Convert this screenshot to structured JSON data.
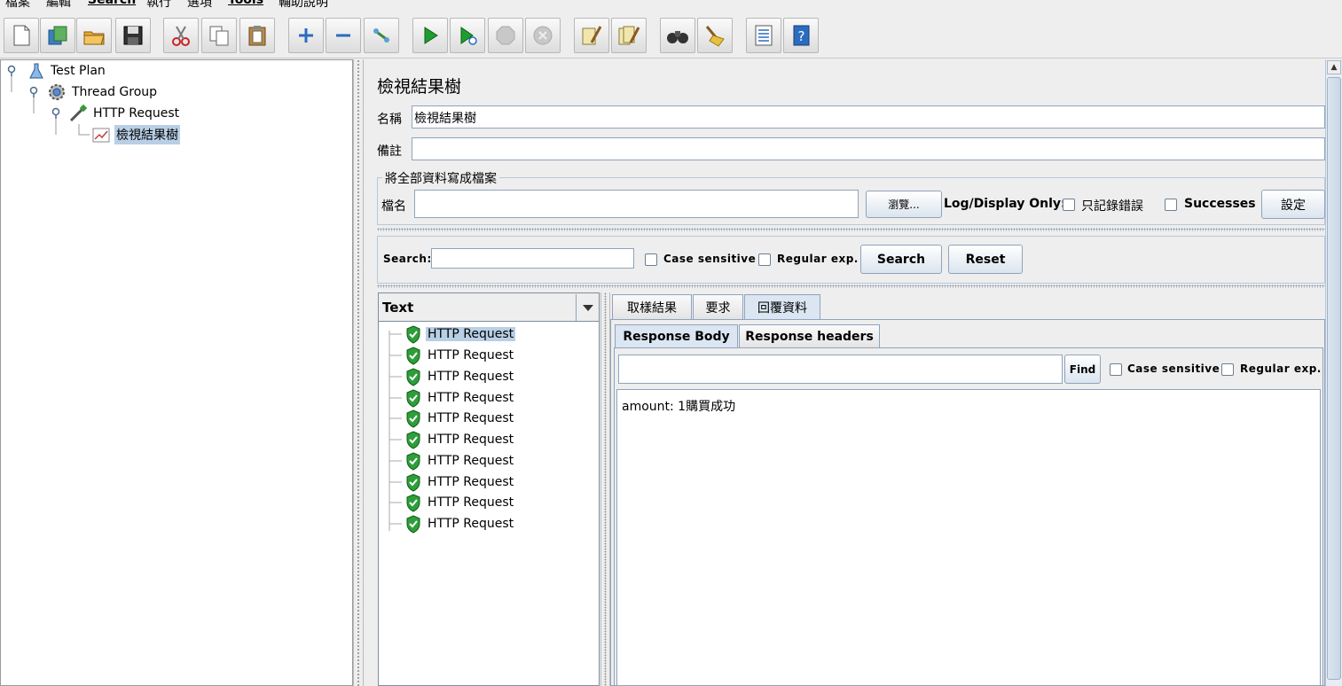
{
  "menu": {
    "items": [
      "檔案",
      "編輯",
      "Search",
      "執行",
      "選項",
      "Tools",
      "輔助說明"
    ]
  },
  "toolbar": {
    "buttons": [
      "new-icon",
      "templates-icon",
      "open-icon",
      "save-icon",
      "cut-icon",
      "copy-icon",
      "paste-icon",
      "expand-icon",
      "collapse-icon",
      "toggle-icon",
      "start-icon",
      "start-no-pause-icon",
      "stop-icon",
      "shutdown-icon",
      "clear-icon",
      "clear-all-icon",
      "search-icon",
      "reset-search-icon",
      "function-helper-icon",
      "help-icon"
    ]
  },
  "tree": {
    "nodes": [
      {
        "label": "Test Plan",
        "icon": "test-plan-icon"
      },
      {
        "label": "Thread Group",
        "icon": "thread-group-icon"
      },
      {
        "label": "HTTP Request",
        "icon": "sampler-icon"
      },
      {
        "label": "檢視結果樹",
        "icon": "listener-icon"
      }
    ]
  },
  "panel": {
    "title": "檢視結果樹",
    "name_label": "名稱",
    "name_value": "檢視結果樹",
    "comment_label": "備註",
    "comment_value": "",
    "file_group_title": "將全部資料寫成檔案",
    "filename_label": "檔名",
    "filename_value": "",
    "browse_label": "瀏覽...",
    "log_display_label": "Log/Display Only:",
    "errors_only_label": "只記錄錯誤",
    "successes_label": "Successes",
    "configure_label": "設定"
  },
  "search": {
    "label": "Search:",
    "value": "",
    "case_sensitive_label": "Case sensitive",
    "regex_label": "Regular exp.",
    "search_button": "Search",
    "reset_button": "Reset"
  },
  "results": {
    "renderer": "Text",
    "items": [
      "HTTP Request",
      "HTTP Request",
      "HTTP Request",
      "HTTP Request",
      "HTTP Request",
      "HTTP Request",
      "HTTP Request",
      "HTTP Request",
      "HTTP Request",
      "HTTP Request"
    ],
    "status_color": "#2e9e3a"
  },
  "detail": {
    "tabs": [
      "取樣結果",
      "要求",
      "回覆資料"
    ],
    "subtabs": [
      "Response Body",
      "Response headers"
    ],
    "find_value": "",
    "find_button": "Find",
    "case_sensitive_label": "Case sensitive",
    "regex_label": "Regular exp.",
    "response_body": "amount: 1購買成功"
  },
  "colors": {
    "selection": "#b8cfe5",
    "border": "#8ea4bc",
    "background": "#eeeeee"
  }
}
